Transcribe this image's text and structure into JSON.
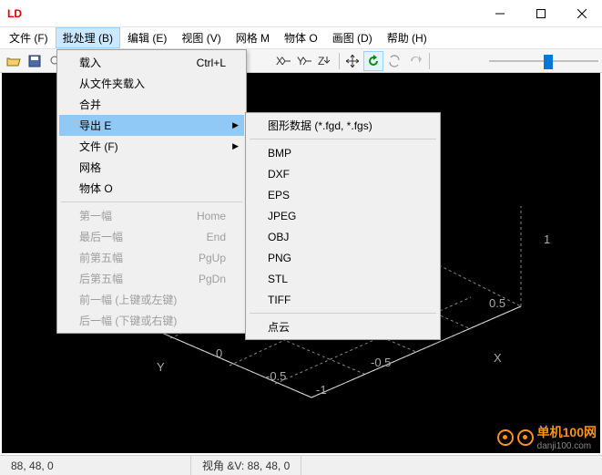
{
  "titlebar": {
    "icon_text": "LD"
  },
  "menubar": {
    "items": [
      {
        "label": "文件 (F)"
      },
      {
        "label": "批处理 (B)"
      },
      {
        "label": "编辑 (E)"
      },
      {
        "label": "视图 (V)"
      },
      {
        "label": "网格 M"
      },
      {
        "label": "物体 O"
      },
      {
        "label": "画图 (D)"
      },
      {
        "label": "帮助 (H)"
      }
    ]
  },
  "dropdown": {
    "load": "载入",
    "load_key": "Ctrl+L",
    "load_folder": "从文件夹载入",
    "merge": "合并",
    "export": "导出 E",
    "file": "文件 (F)",
    "grid": "网格",
    "object": "物体 O",
    "first": "第一幅",
    "first_key": "Home",
    "last": "最后一幅",
    "last_key": "End",
    "prev5": "前第五幅",
    "prev5_key": "PgUp",
    "next5": "后第五幅",
    "next5_key": "PgDn",
    "prev1": "前一幅 (上键或左键)",
    "next1": "后一幅 (下键或右键)"
  },
  "submenu": {
    "figdata": "图形数据 (*.fgd, *.fgs)",
    "bmp": "BMP",
    "dxf": "DXF",
    "eps": "EPS",
    "jpeg": "JPEG",
    "obj": "OBJ",
    "png": "PNG",
    "stl": "STL",
    "tiff": "TIFF",
    "pointcloud": "点云"
  },
  "statusbar": {
    "coords": "88, 48, 0",
    "view": "视角 &V: 88, 48, 0"
  },
  "axes": {
    "x": "X",
    "y": "Y",
    "ticks": {
      "neg1": "-1",
      "neg05": "-0.5",
      "zero": "0",
      "pos05": "0.5",
      "pos1": "1"
    }
  },
  "watermark": {
    "name": "单机100网",
    "url": "danji100.com"
  },
  "chart_data": {
    "type": "3d-axes",
    "title": "",
    "x_range": [
      -1,
      1
    ],
    "y_range": [
      -1,
      1
    ],
    "z_range": [
      -1,
      1
    ],
    "x_ticks": [
      -1,
      -0.5,
      0,
      0.5,
      1
    ],
    "y_ticks": [
      -1,
      -0.5,
      0,
      0.5,
      1
    ],
    "z_ticks": [
      -1,
      -0.5,
      0,
      0.5,
      1
    ],
    "series": []
  }
}
